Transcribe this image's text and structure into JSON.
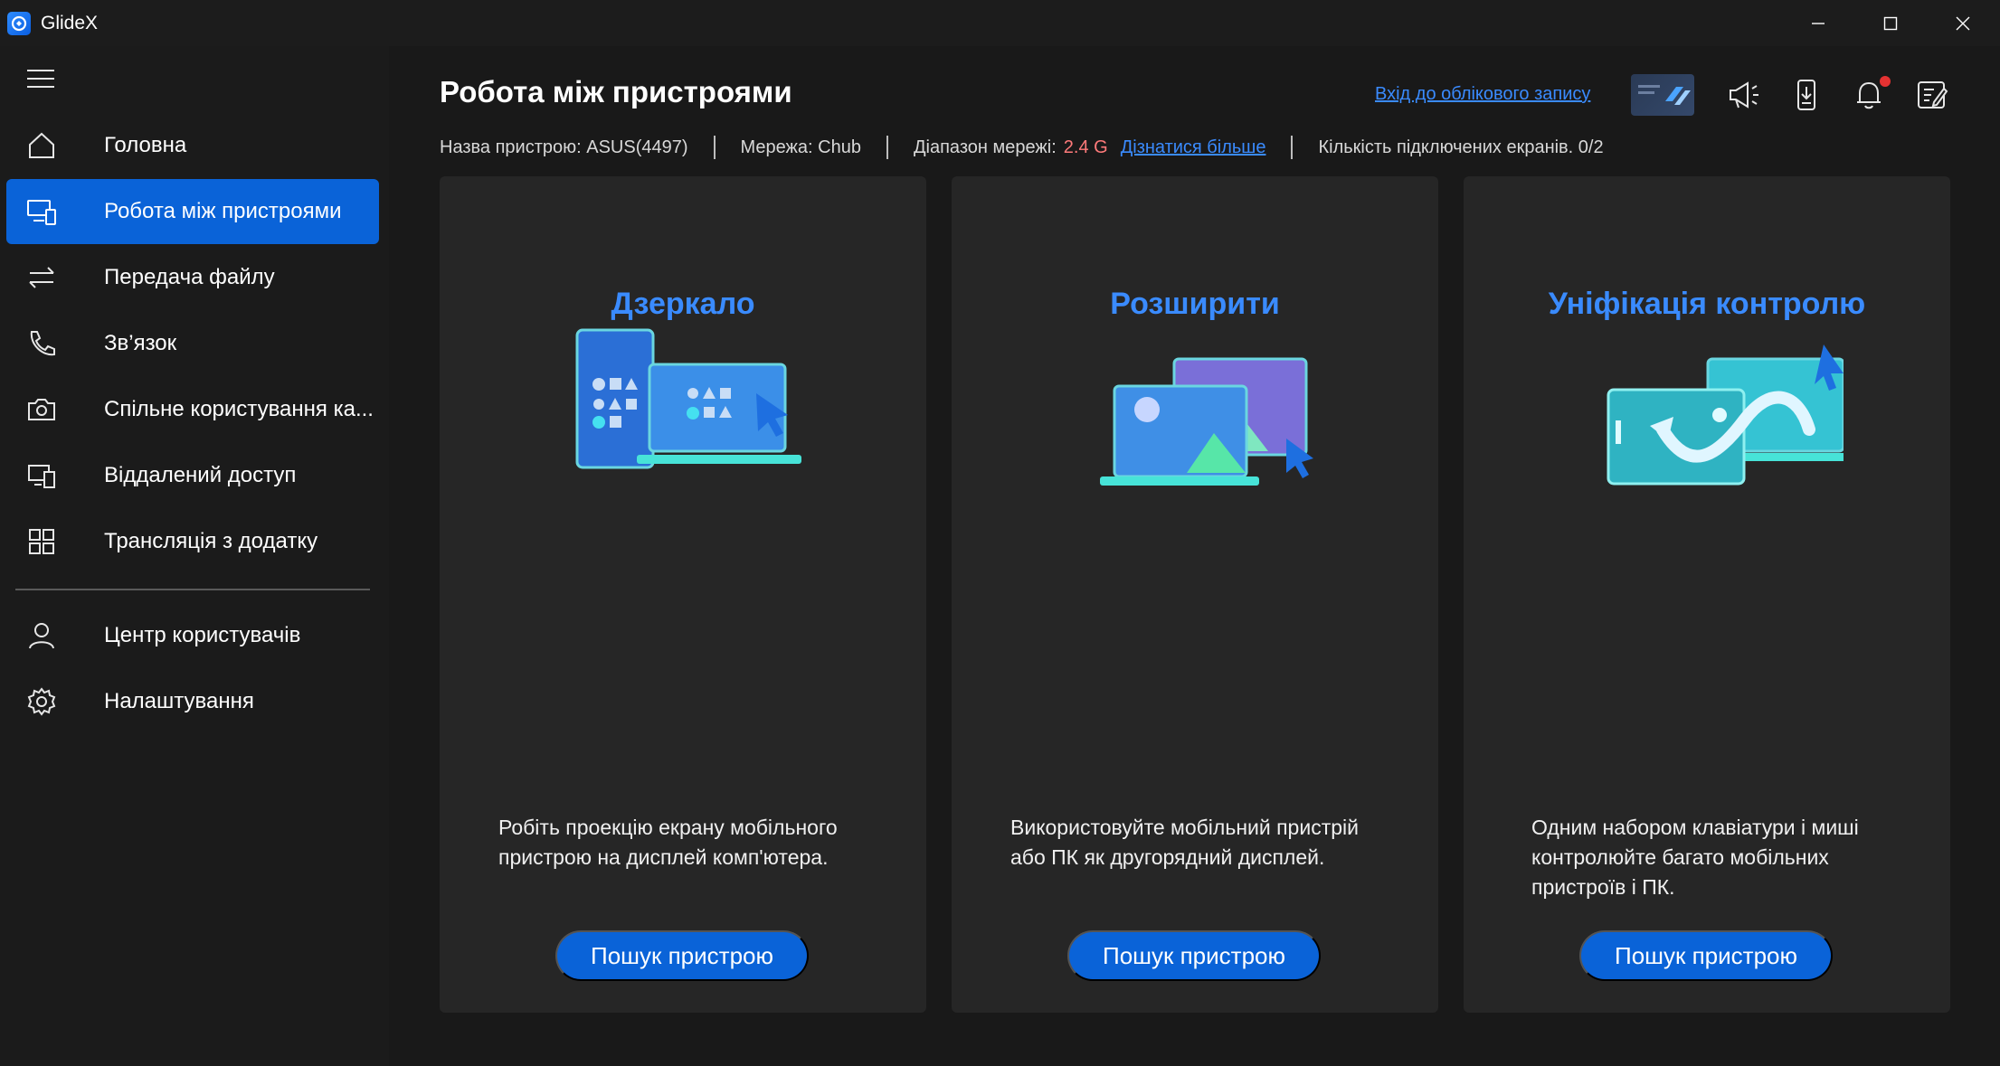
{
  "window": {
    "title": "GlideX"
  },
  "sidebar": {
    "items": [
      {
        "label": "Головна",
        "icon": "home-icon"
      },
      {
        "label": "Робота між пристроями",
        "icon": "cross-device-icon"
      },
      {
        "label": "Передача файлу",
        "icon": "transfer-arrows-icon"
      },
      {
        "label": "Зв’язок",
        "icon": "phone-icon"
      },
      {
        "label": "Спільне користування ка...",
        "icon": "camera-icon"
      },
      {
        "label": "Віддалений доступ",
        "icon": "remote-access-icon"
      },
      {
        "label": "Трансляція з додатку",
        "icon": "app-grid-icon"
      }
    ],
    "bottom_items": [
      {
        "label": "Центр користувачів",
        "icon": "user-icon"
      },
      {
        "label": "Налаштування",
        "icon": "gear-icon"
      }
    ],
    "active_index": 1
  },
  "header": {
    "title": "Робота між пристроями",
    "login_link": "Вхід до облікового запису"
  },
  "info": {
    "device_name": "Назва пристрою: ASUS(4497)",
    "network": "Мережа: Chub",
    "band_label": "Діапазон мережі:",
    "band_value": "2.4 G",
    "learn_more": "Дізнатися більше",
    "connected_screens": "Кількість підключених екранів. 0/2"
  },
  "cards": [
    {
      "title": "Дзеркало",
      "description": "Робіть проекцію екрану мобільного пристрою на дисплей комп'ютера.",
      "button": "Пошук пристрою"
    },
    {
      "title": "Розширити",
      "description": "Використовуйте мобільний пристрій або ПК як другорядний дисплей.",
      "button": "Пошук пристрою"
    },
    {
      "title": "Уніфікація контролю",
      "description": "Одним набором клавіатури і миші контролюйте багато мобільних пристроїв і ПК.",
      "button": "Пошук пристрою"
    }
  ],
  "colors": {
    "accent": "#0a63d8",
    "link": "#3a8bff",
    "highlight": "#ff7a7a",
    "sidebar_bg": "#1b1b1b",
    "card_bg": "#262626"
  }
}
